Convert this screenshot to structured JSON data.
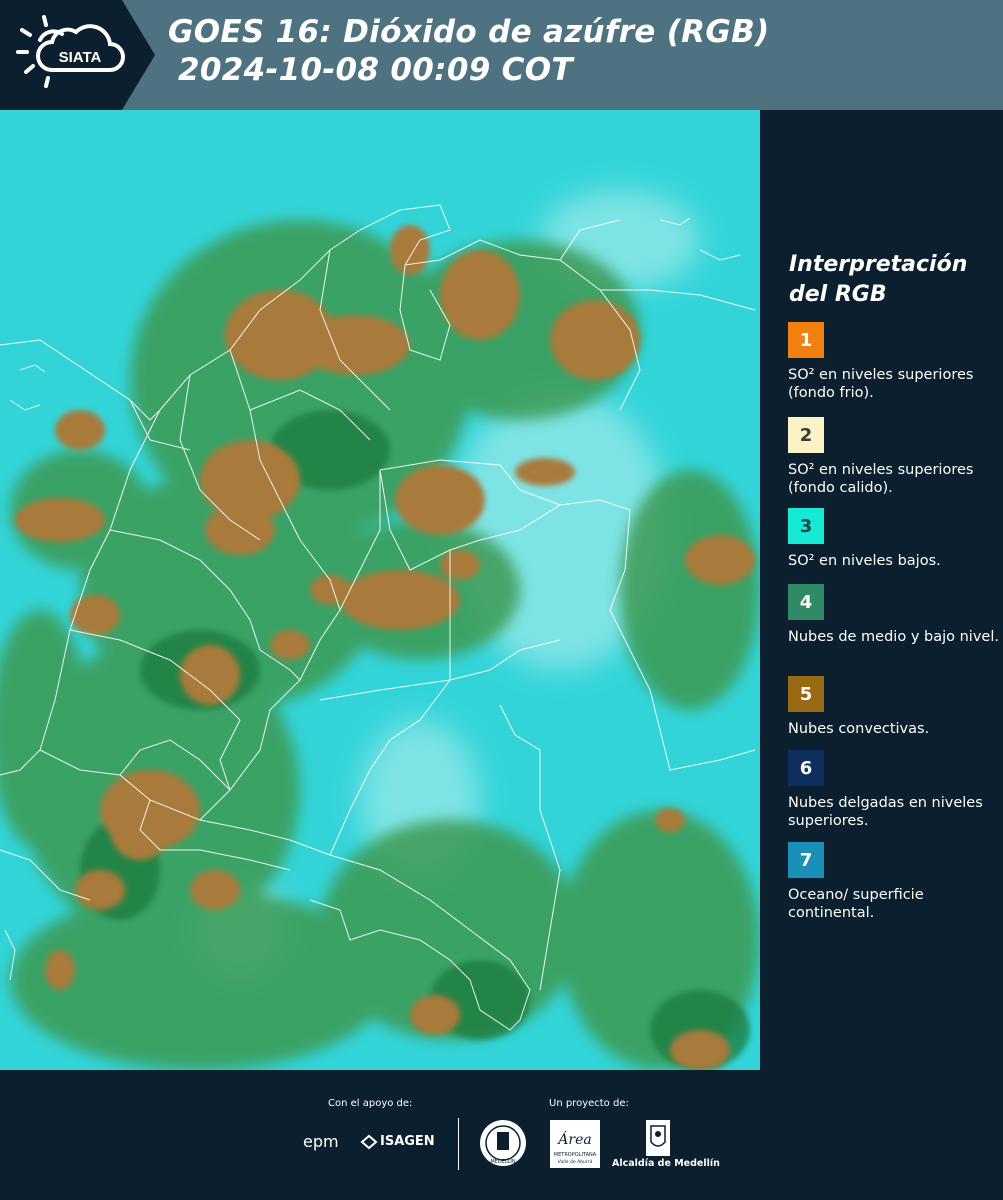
{
  "header": {
    "logo_text": "SIATA",
    "title_line1": "GOES 16: Dióxido de azúfre (RGB)",
    "title_line2": "2024-10-08 00:09 COT"
  },
  "legend": {
    "title": "Interpretación del RGB",
    "items": [
      {
        "number": "1",
        "color": "#f2800f",
        "text": "SO² en niveles superiores (fondo frio)."
      },
      {
        "number": "2",
        "color": "#fbf3c4",
        "text": "SO² en niveles superiores (fondo calido)."
      },
      {
        "number": "3",
        "color": "#14ead4",
        "text": "SO² en niveles bajos."
      },
      {
        "number": "4",
        "color": "#2f8a66",
        "text": "Nubes de medio y bajo nivel."
      },
      {
        "number": "5",
        "color": "#9a6a12",
        "text": "Nubes convectivas."
      },
      {
        "number": "6",
        "color": "#0c2f5e",
        "text": "Nubes delgadas en niveles superiores."
      },
      {
        "number": "7",
        "color": "#1a8fb8",
        "text": "Oceano/ superficie continental."
      }
    ]
  },
  "footer": {
    "support_label": "Con el apoyo de:",
    "project_label": "Un proyecto de:",
    "epm": "epm",
    "isagen": "ISAGEN",
    "area_name": "Área",
    "area_sub": "METROPOLITANA",
    "area_sub2": "Valle de Aburrá",
    "alcaldia": "Alcaldía de Medellín",
    "medellin_seal": "MEDELLÍN"
  },
  "colors": {
    "header_band": "#4f7280",
    "background": "#0b1f2e",
    "map_base": "#33d4d8",
    "vegetation_green": "#3d9a52",
    "convective_brown": "#a87a3a",
    "border_line": "#ffffff"
  }
}
